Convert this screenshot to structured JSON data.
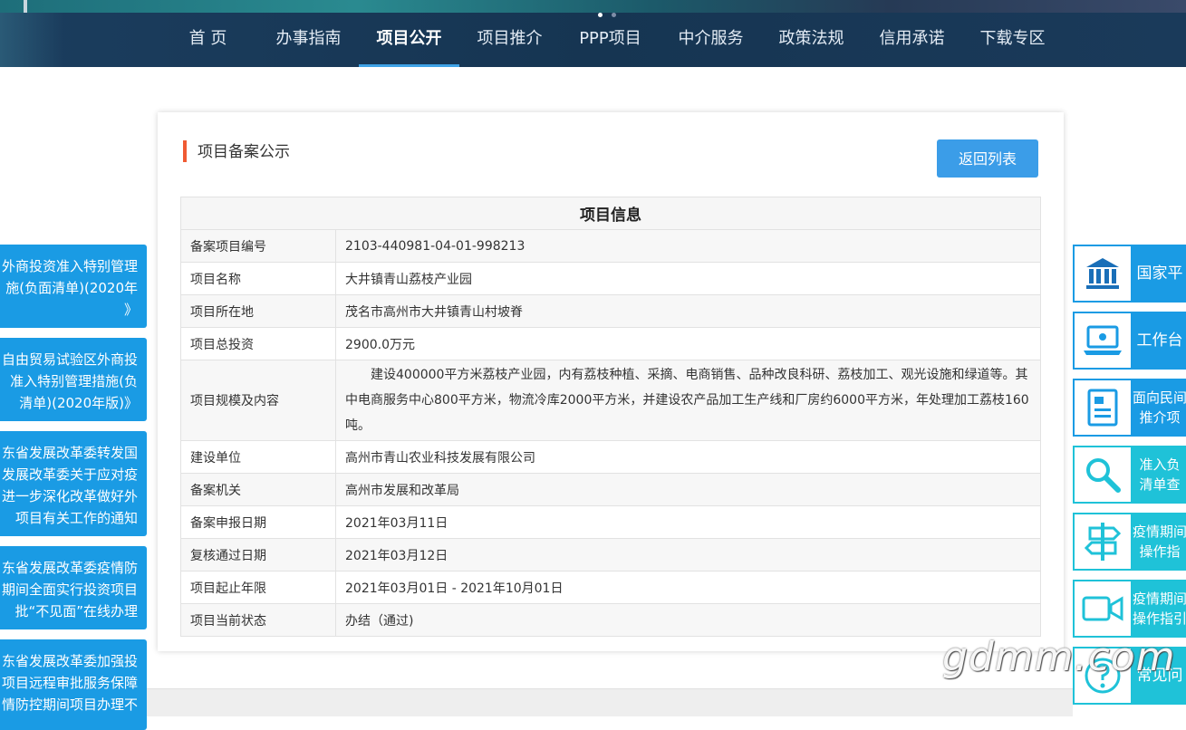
{
  "nav": {
    "items": [
      "首 页",
      "办事指南",
      "项目公开",
      "项目推介",
      "PPP项目",
      "中介服务",
      "政策法规",
      "信用承诺",
      "下载专区"
    ],
    "active_index": 2
  },
  "left_notices": [
    {
      "lines": [
        "外商投资准入特别管理",
        "施(负面清单)(2020年",
        "》"
      ]
    },
    {
      "lines": [
        "自由贸易试验区外商投",
        "准入特别管理措施(负",
        "清单)(2020年版)》"
      ]
    },
    {
      "lines": [
        "东省发展改革委转发国",
        "发展改革委关于应对疫",
        "进一步深化改革做好外",
        "项目有关工作的通知"
      ]
    },
    {
      "lines": [
        "东省发展改革委疫情防",
        "期间全面实行投资项目",
        "批“不见面”在线办理"
      ]
    },
    {
      "lines": [
        "东省发展改革委加强投",
        "项目远程审批服务保障",
        "情防控期间项目办理不"
      ]
    }
  ],
  "card": {
    "title": "项目备案公示",
    "back_button": "返回列表"
  },
  "table": {
    "header": "项目信息",
    "rows": [
      {
        "key": "备案项目编号",
        "value": "2103-440981-04-01-998213"
      },
      {
        "key": "项目名称",
        "value": "大井镇青山荔枝产业园"
      },
      {
        "key": "项目所在地",
        "value": "茂名市高州市大井镇青山村坡脊"
      },
      {
        "key": "项目总投资",
        "value": "2900.0万元"
      },
      {
        "key": "项目规模及内容",
        "value": "建设400000平方米荔枝产业园，内有荔枝种植、采摘、电商销售、品种改良科研、荔枝加工、观光设施和绿道等。其中电商服务中心800平方米，物流冷库2000平方米，并建设农产品加工生产线和厂房约6000平方米，年处理加工荔枝160吨。"
      },
      {
        "key": "建设单位",
        "value": "高州市青山农业科技发展有限公司"
      },
      {
        "key": "备案机关",
        "value": "高州市发展和改革局"
      },
      {
        "key": "备案申报日期",
        "value": "2021年03月11日"
      },
      {
        "key": "复核通过日期",
        "value": "2021年03月12日"
      },
      {
        "key": "项目起止年限",
        "value": "2021年03月01日 - 2021年10月01日"
      },
      {
        "key": "项目当前状态",
        "value": "办结（通过)"
      }
    ]
  },
  "shortcuts": [
    {
      "label": "国家平",
      "icon": "bank-icon",
      "style": "blue"
    },
    {
      "label": "工作台",
      "icon": "laptop-icon",
      "style": "blue"
    },
    {
      "label": "面向民间\n推介项",
      "icon": "document-icon",
      "style": "blue"
    },
    {
      "label": "准入负\n清单查",
      "icon": "search-icon",
      "style": "teal"
    },
    {
      "label": "疫情期间\n操作指",
      "icon": "signpost-icon",
      "style": "teal"
    },
    {
      "label": "疫情期间\n操作指引",
      "icon": "video-icon",
      "style": "teal"
    },
    {
      "label": "常见问",
      "icon": "question-icon",
      "style": "teal"
    }
  ],
  "watermark": "gdmm.com",
  "colors": {
    "nav_bg": "#163552",
    "accent_blue": "#1a9be4",
    "accent_teal": "#1fc2d8",
    "title_bar": "#f05a33",
    "button": "#3b9de8"
  }
}
